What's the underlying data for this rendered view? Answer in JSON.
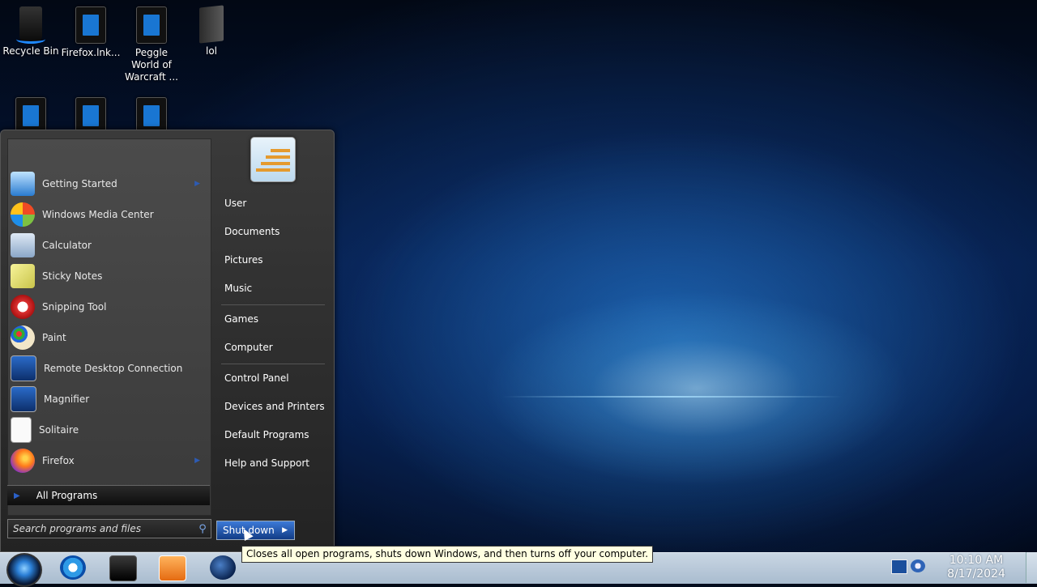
{
  "desktop": {
    "icons": [
      {
        "label": "Recycle Bin"
      },
      {
        "label": "Firefox.lnk..."
      },
      {
        "label": "Peggle World of Warcraft ..."
      },
      {
        "label": "lol"
      }
    ]
  },
  "start_menu": {
    "programs": [
      {
        "label": "Getting Started",
        "icon": "getting-started-icon",
        "has_arrow": true
      },
      {
        "label": "Windows Media Center",
        "icon": "windows-media-center-icon"
      },
      {
        "label": "Calculator",
        "icon": "calculator-icon"
      },
      {
        "label": "Sticky Notes",
        "icon": "sticky-notes-icon"
      },
      {
        "label": "Snipping Tool",
        "icon": "snipping-tool-icon"
      },
      {
        "label": "Paint",
        "icon": "paint-icon"
      },
      {
        "label": "Remote Desktop Connection",
        "icon": "remote-desktop-icon"
      },
      {
        "label": "Magnifier",
        "icon": "magnifier-icon"
      },
      {
        "label": "Solitaire",
        "icon": "solitaire-icon"
      },
      {
        "label": "Firefox",
        "icon": "firefox-icon",
        "has_arrow": true
      }
    ],
    "all_programs": "All Programs",
    "search_placeholder": "Search programs and files",
    "right_items": [
      {
        "label": "User"
      },
      {
        "label": "Documents"
      },
      {
        "label": "Pictures"
      },
      {
        "label": "Music"
      },
      {
        "label": "Games"
      },
      {
        "label": "Computer"
      },
      {
        "label": "Control Panel"
      },
      {
        "label": "Devices and Printers"
      },
      {
        "label": "Default Programs"
      },
      {
        "label": "Help and Support"
      }
    ],
    "shutdown_label": "Shut down",
    "tooltip": "Closes all open programs, shuts down Windows, and then turns off your computer."
  },
  "taskbar": {
    "pinned": [
      "internet-explorer-icon",
      "terminal-icon",
      "media-player-icon",
      "globe-icon"
    ],
    "tray": [
      "network-icon",
      "volume-icon"
    ],
    "time": "10:10 AM",
    "date": "8/17/2024"
  },
  "colors": {
    "accent": "#2b61c8",
    "taskbar": "#b9c9da",
    "tooltip_bg": "#ffffe1"
  }
}
